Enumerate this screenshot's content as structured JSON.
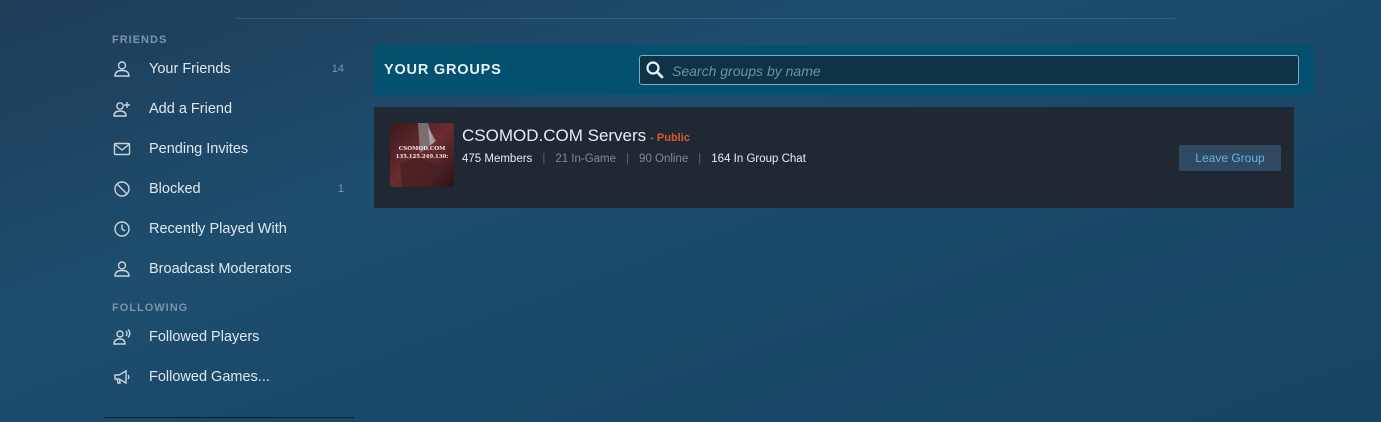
{
  "sidebar": {
    "friends_label": "FRIENDS",
    "following_label": "FOLLOWING",
    "items": [
      {
        "label": "Your Friends",
        "count": "14",
        "icon": "person-icon"
      },
      {
        "label": "Add a Friend",
        "count": "",
        "icon": "add-person-icon"
      },
      {
        "label": "Pending Invites",
        "count": "",
        "icon": "envelope-icon"
      },
      {
        "label": "Blocked",
        "count": "1",
        "icon": "blocked-icon"
      },
      {
        "label": "Recently Played With",
        "count": "",
        "icon": "clock-icon"
      },
      {
        "label": "Broadcast Moderators",
        "count": "",
        "icon": "person-icon"
      }
    ],
    "following_items": [
      {
        "label": "Followed Players",
        "icon": "person-broadcast-icon"
      },
      {
        "label": "Followed Games...",
        "icon": "megaphone-icon"
      }
    ]
  },
  "header": {
    "title": "YOUR GROUPS",
    "search_placeholder": "Search groups by name",
    "search_value": ""
  },
  "groups": [
    {
      "name": "CSOMOD.COM Servers",
      "visibility": "- Public",
      "avatar_text_1": "CSOMOD.COM",
      "avatar_text_2": "135.125.249.130:",
      "members": "475 Members",
      "in_game": "21 In-Game",
      "online": "90 Online",
      "in_chat": "164 In Group Chat",
      "action_label": "Leave Group"
    }
  ],
  "colors": {
    "accent": "#04506f",
    "public": "#d65a2d",
    "button_text": "#66b1e8",
    "card_bg": "#1f2833"
  }
}
